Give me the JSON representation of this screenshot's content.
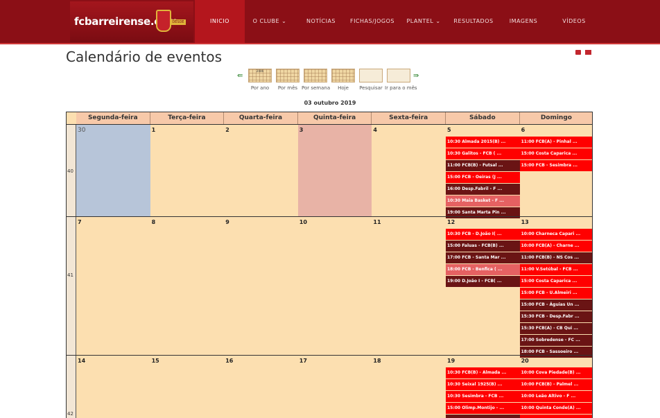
{
  "site": {
    "logo_text": "fcbarreirense.com",
    "crest_badge": "DESDE 1911"
  },
  "nav": [
    {
      "label": "INICIO",
      "active": true
    },
    {
      "label": "O CLUBE ⌄",
      "active": false
    },
    {
      "label": "NOTÍCIAS",
      "active": false
    },
    {
      "label": "FICHAS/JOGOS",
      "active": false
    },
    {
      "label": "PLANTEL ⌄",
      "active": false
    },
    {
      "label": "RESULTADOS",
      "active": false
    },
    {
      "label": "IMAGENS",
      "active": false
    },
    {
      "label": "VÍDEOS",
      "active": false
    }
  ],
  "page": {
    "title": "Calendário de eventos",
    "current_date": "03 outubro 2019"
  },
  "toolbar": [
    {
      "label": "Por ano",
      "icon": "year-view-icon"
    },
    {
      "label": "Por mês",
      "icon": "month-view-icon"
    },
    {
      "label": "Por semana",
      "icon": "week-view-icon"
    },
    {
      "label": "Hoje",
      "icon": "today-icon"
    },
    {
      "label": "Pesquisar",
      "icon": "search-icon"
    },
    {
      "label": "Ir para o mês",
      "icon": "goto-month-icon"
    }
  ],
  "toolbar_year_icon_text": "2006",
  "calendar": {
    "weekdays": [
      "Segunda-feira",
      "Terça-feira",
      "Quarta-feira",
      "Quinta-feira",
      "Sexta-feira",
      "Sábado",
      "Domingo"
    ],
    "weeks": [
      {
        "week": "40",
        "days": [
          "30",
          "1",
          "2",
          "3",
          "4",
          "5",
          "6"
        ],
        "sat": [
          {
            "t": "10:30 Almada 2015(B) ...",
            "c": "red"
          },
          {
            "t": "10:30 Galitos - FCB ( ...",
            "c": "red"
          },
          {
            "t": "11:00 FCB(B) - Futsal ...",
            "c": "dark"
          },
          {
            "t": "15:00 FCB - Oeiras (J ...",
            "c": "red"
          },
          {
            "t": "16:00 Desp.Fabril - F ...",
            "c": "dark"
          },
          {
            "t": "10:30 Maia Basket - F ...",
            "c": "pink"
          },
          {
            "t": "19:00 Santa Marta Pin ...",
            "c": "dark"
          }
        ],
        "sun": [
          {
            "t": "11:00 FCB(A) - Pinhal ...",
            "c": "red"
          },
          {
            "t": "15:00 Costa Caparica ...",
            "c": "red"
          },
          {
            "t": "15:00 FCB - Sesimbra ...",
            "c": "red"
          }
        ]
      },
      {
        "week": "41",
        "days": [
          "7",
          "8",
          "9",
          "10",
          "11",
          "12",
          "13"
        ],
        "sat": [
          {
            "t": "10:30 FCB - D.João I( ...",
            "c": "red"
          },
          {
            "t": "15:00 Faluas - FCB(B) ...",
            "c": "dark"
          },
          {
            "t": "17:00 FCB - Santa Mar ...",
            "c": "dark"
          },
          {
            "t": "18:00 FCB - Benfica ( ...",
            "c": "pink"
          },
          {
            "t": "19:00 D.João I - FCB( ...",
            "c": "dark"
          }
        ],
        "sun": [
          {
            "t": "10:00 Charneca Capari ...",
            "c": "red"
          },
          {
            "t": "10:00 FCB(A) - Charne ...",
            "c": "red"
          },
          {
            "t": "11:00 FCB(B) - NS Cos ...",
            "c": "dark"
          },
          {
            "t": "11:00 V.Setúbal - FCB ...",
            "c": "red"
          },
          {
            "t": "15:00 Costa Caparica ...",
            "c": "red"
          },
          {
            "t": "15:00 FCB - U.Almeiri ...",
            "c": "red"
          },
          {
            "t": "15:00 FCB - Águias Un ...",
            "c": "dark"
          },
          {
            "t": "15:30 FCB - Desp.Fabr ...",
            "c": "dark"
          },
          {
            "t": "15:30 FCB(A) - CB Qui ...",
            "c": "dark"
          },
          {
            "t": "17:00 Sobredense - FC ...",
            "c": "dark"
          },
          {
            "t": "18:00 FCB - Sassoeiro ...",
            "c": "dark"
          }
        ]
      },
      {
        "week": "42",
        "days": [
          "14",
          "15",
          "16",
          "17",
          "18",
          "19",
          "20"
        ],
        "sat": [
          {
            "t": "10:30 FCB(B) - Almada ...",
            "c": "red"
          },
          {
            "t": "10:30 Seixal 1925(B) ...",
            "c": "red"
          },
          {
            "t": "10:30 Sesimbra - FCB ...",
            "c": "red"
          },
          {
            "t": "15:00 Olimp.Montijo - ...",
            "c": "red"
          },
          {
            "t": "",
            "c": "dark"
          }
        ],
        "sun": [
          {
            "t": "10:00 Cova Piedade(B) ...",
            "c": "red"
          },
          {
            "t": "10:00 FCB(B) - Palmel ...",
            "c": "red"
          },
          {
            "t": "10:00 Leão Altivo - F ...",
            "c": "red"
          },
          {
            "t": "10:00 Quinta Conde(A) ...",
            "c": "red"
          },
          {
            "t": "",
            "c": "red"
          }
        ]
      }
    ]
  },
  "colors": {
    "header_bg": "#8b0f16",
    "nav_active": "#b4161d",
    "calendar_bg": "#fcdfb0",
    "event_red": "#ff0000",
    "event_dark": "#6a1414",
    "event_pink": "#e56162",
    "prev_month_cell": "#b7c5d9",
    "today_cell": "#e8b3a6"
  }
}
